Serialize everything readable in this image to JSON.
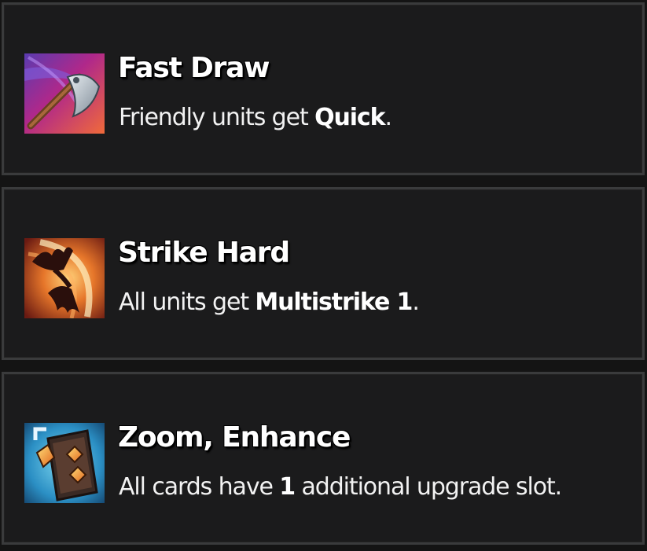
{
  "upgrades": [
    {
      "title": "Fast Draw",
      "icon": "axe-icon",
      "accent": "#b23a8a",
      "desc_before": "Friendly units get ",
      "keyword": "Quick",
      "desc_after": "."
    },
    {
      "title": "Strike Hard",
      "icon": "claw-slash-icon",
      "accent": "#e0782a",
      "desc_before": "All units get ",
      "keyword": "Multistrike 1",
      "desc_after": "."
    },
    {
      "title": "Zoom, Enhance",
      "icon": "card-upgrade-icon",
      "accent": "#2b8fc4",
      "desc_before": "All cards have ",
      "keyword": "1",
      "desc_after": " additional upgrade slot."
    }
  ]
}
